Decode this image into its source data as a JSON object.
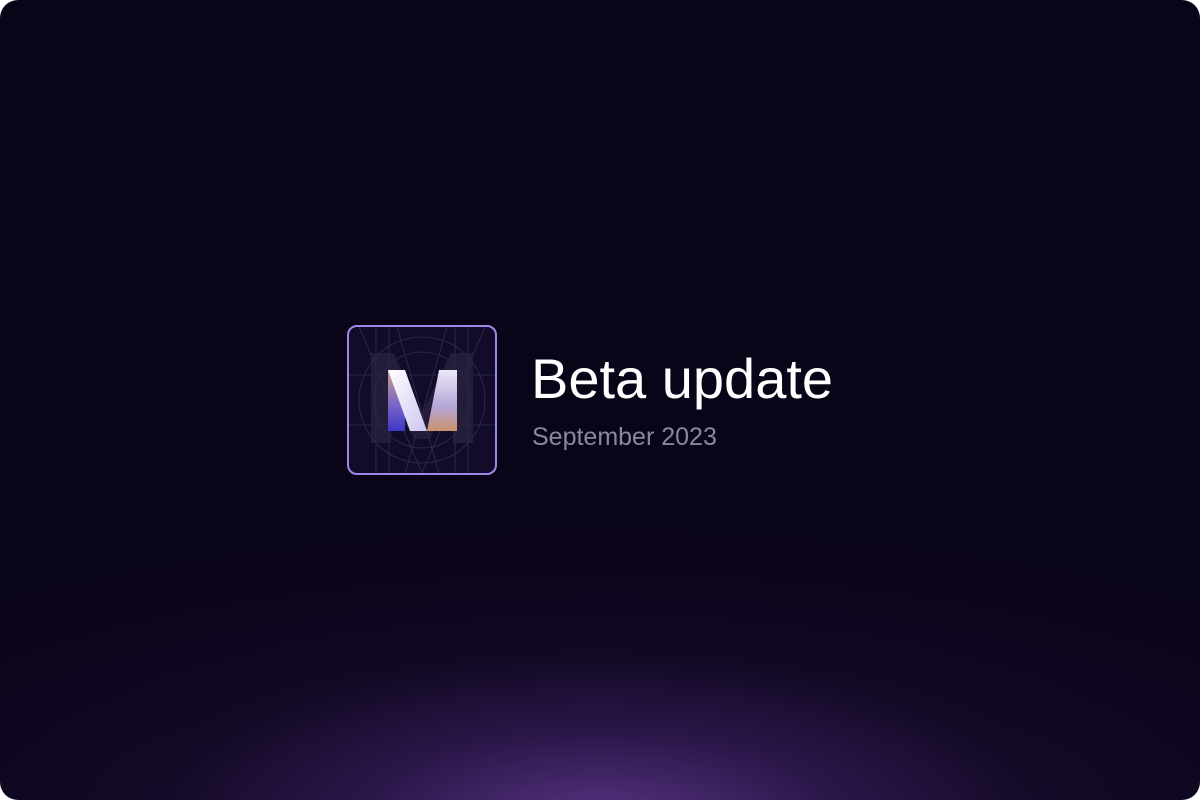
{
  "announcement": {
    "title": "Beta update",
    "date": "September 2023"
  },
  "logo": {
    "icon": "m-logo-icon",
    "border_color": "#9f86ea",
    "tile_color": "#120b2a"
  },
  "colors": {
    "background": "#0a0418",
    "glow": "#804eb9",
    "title": "#ffffff",
    "subtitle": "#8a8799"
  }
}
